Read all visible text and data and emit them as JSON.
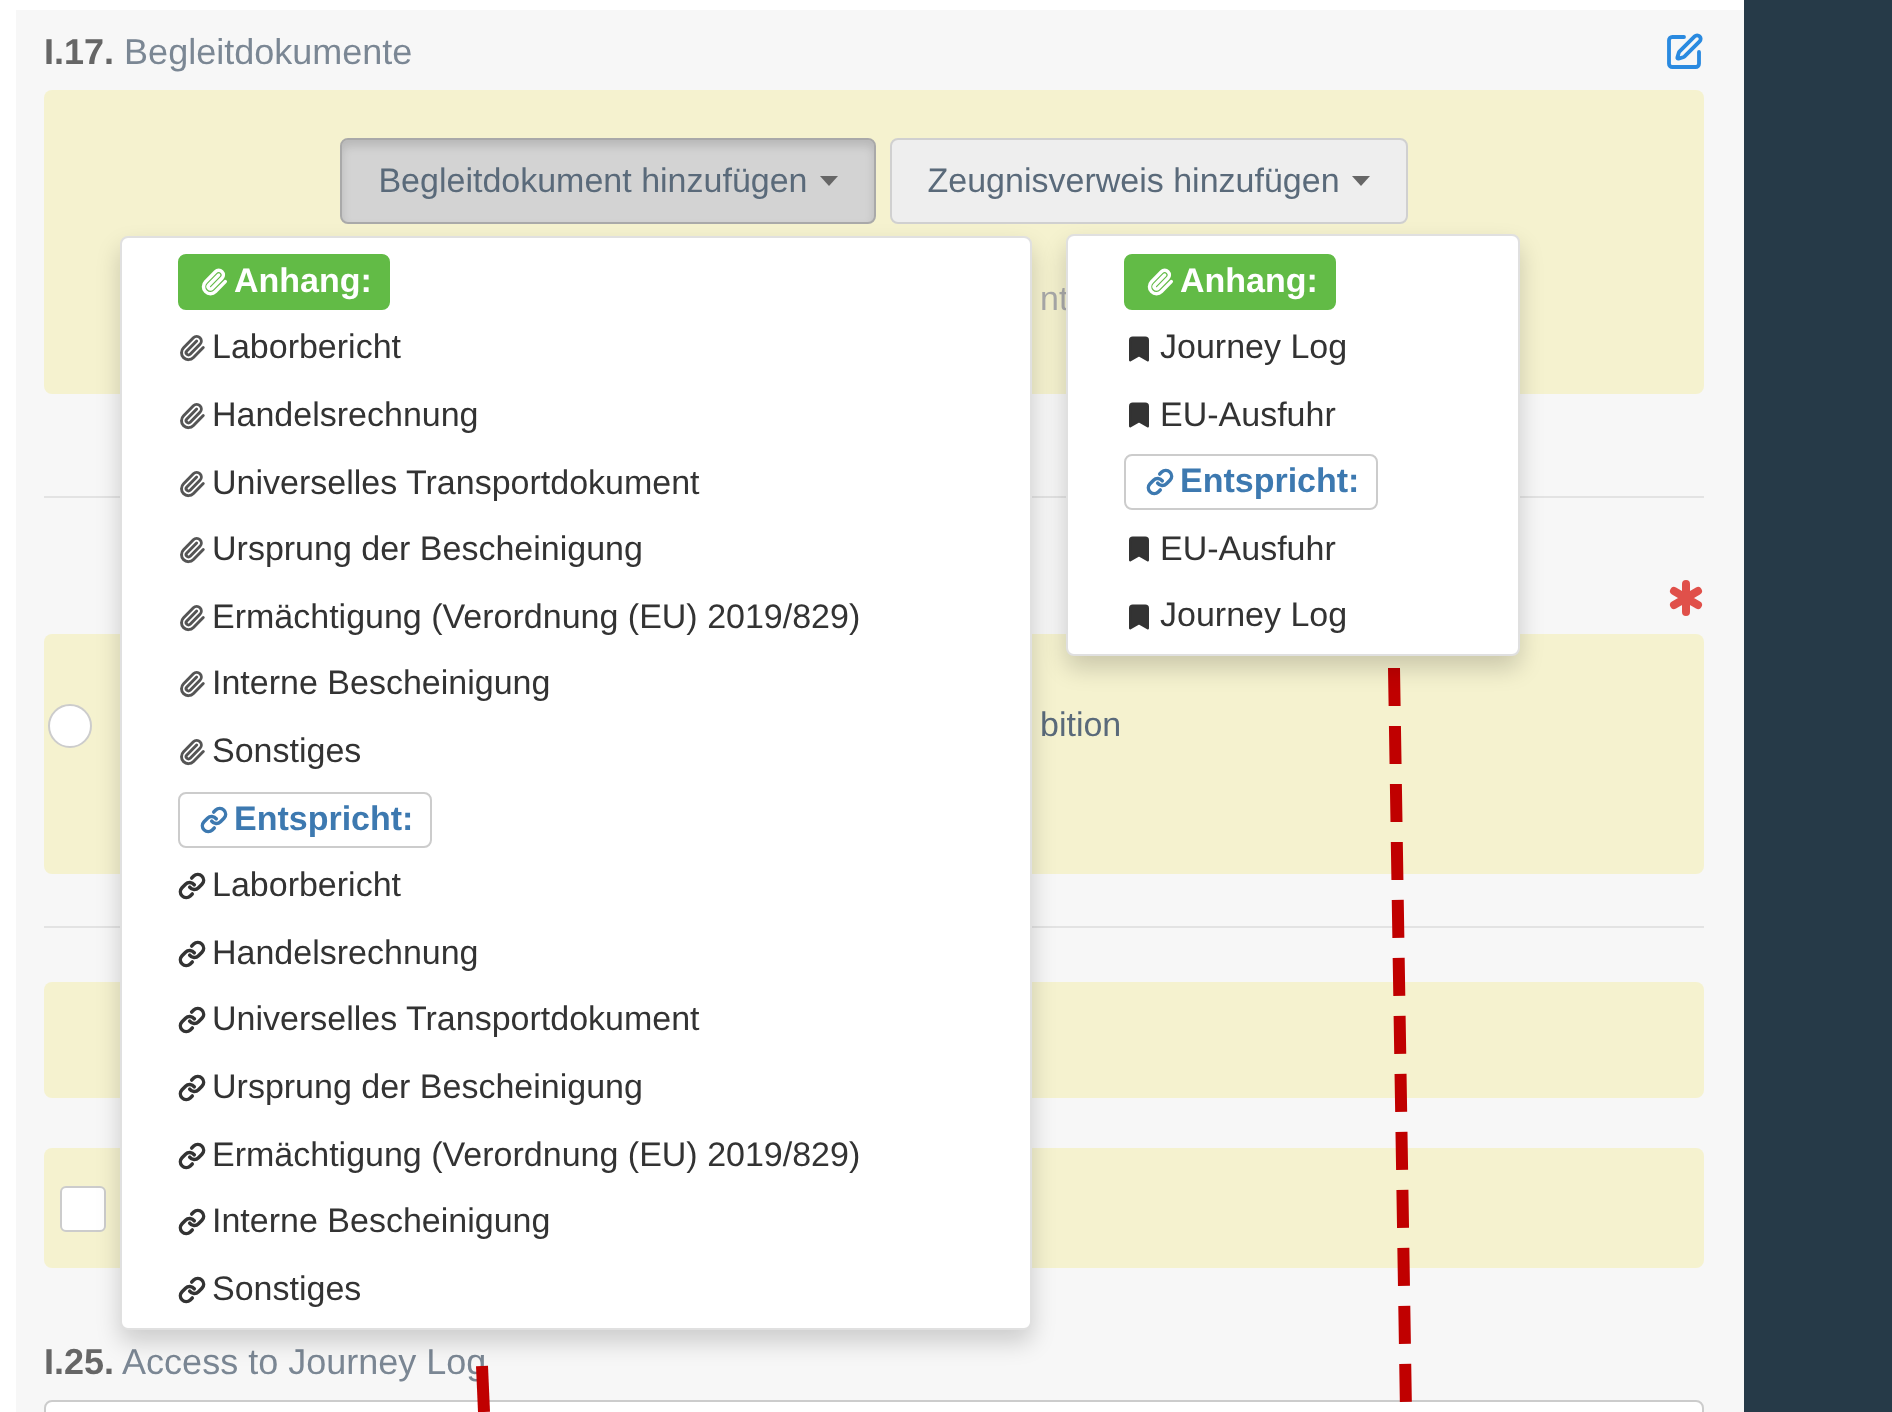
{
  "documents_section": {
    "number": "I.17.",
    "title": "Begleitdokumente"
  },
  "add_buttons": [
    {
      "label": "Begleitdokument hinzufügen",
      "pressed": true
    },
    {
      "label": "Zeugnisverweis hinzufügen",
      "pressed": false
    }
  ],
  "panel_text": "nt",
  "document_menu": [
    {
      "kind": "attachment_header",
      "label": "Anhang:"
    },
    {
      "kind": "attachment",
      "label": "Laborbericht"
    },
    {
      "kind": "attachment",
      "label": "Handelsrechnung"
    },
    {
      "kind": "attachment",
      "label": "Universelles Transportdokument"
    },
    {
      "kind": "attachment",
      "label": "Ursprung der Bescheinigung"
    },
    {
      "kind": "attachment",
      "label": "Ermächtigung (Verordnung (EU) 2019/829)"
    },
    {
      "kind": "attachment",
      "label": "Interne Bescheinigung"
    },
    {
      "kind": "attachment",
      "label": "Sonstiges"
    },
    {
      "kind": "match_header",
      "label": "Entspricht:"
    },
    {
      "kind": "match",
      "label": "Laborbericht"
    },
    {
      "kind": "match",
      "label": "Handelsrechnung"
    },
    {
      "kind": "match",
      "label": "Universelles Transportdokument"
    },
    {
      "kind": "match",
      "label": "Ursprung der Bescheinigung"
    },
    {
      "kind": "match",
      "label": "Ermächtigung (Verordnung (EU) 2019/829)"
    },
    {
      "kind": "match",
      "label": "Interne Bescheinigung"
    },
    {
      "kind": "match",
      "label": "Sonstiges"
    }
  ],
  "reference_menu": [
    {
      "kind": "attachment_header",
      "label": "Anhang:"
    },
    {
      "kind": "bookmark",
      "label": "Journey Log"
    },
    {
      "kind": "bookmark",
      "label": "EU-Ausfuhr"
    },
    {
      "kind": "match_header",
      "label": "Entspricht:"
    },
    {
      "kind": "bookmark",
      "label": "EU-Ausfuhr"
    },
    {
      "kind": "bookmark",
      "label": "Journey Log"
    }
  ],
  "radio_option": {
    "label": "bition",
    "selected": false
  },
  "checkbox": {
    "checked": false
  },
  "journey_log_section": {
    "number": "I.25.",
    "title": "Access to Journey Log"
  }
}
